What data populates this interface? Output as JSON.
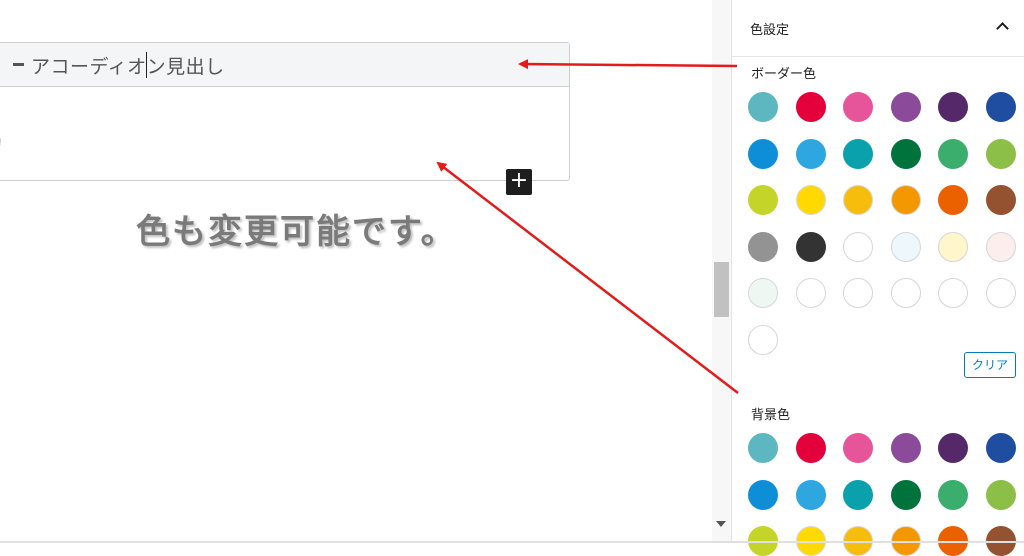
{
  "editor": {
    "accordion_title": "アコーディオン見出し",
    "body_placeholder": "カ",
    "add_block_symbol": "+",
    "caption": "色も変更可能です。"
  },
  "sidebar": {
    "panel_title": "色設定",
    "border_label": "ボーダー色",
    "background_label": "背景色",
    "clear_label": "クリア",
    "border_colors": [
      "#5db7c1",
      "#e4003a",
      "#e6549a",
      "#8b4a9a",
      "#55286a",
      "#1f4ea0",
      "#0f8ed8",
      "#2ea7e0",
      "#0aa1ad",
      "#00733d",
      "#3bae6e",
      "#8bbf47",
      "#c5d428",
      "#ffd900",
      "#f7bd0d",
      "#f39800",
      "#eb6100",
      "#955230",
      "#939393",
      "#333333",
      "#ffffff",
      "#eef7fb",
      "#fff6cc",
      "#fdeeee",
      "#eef7f1",
      "#ffffff",
      "#ffffff",
      "#ffffff",
      "#ffffff",
      "#ffffff",
      "#ffffff"
    ],
    "background_colors": [
      "#5db7c1",
      "#e4003a",
      "#e6549a",
      "#8b4a9a",
      "#55286a",
      "#1f4ea0",
      "#0f8ed8",
      "#2ea7e0",
      "#0aa1ad",
      "#00733d",
      "#3bae6e",
      "#8bbf47",
      "#c5d428",
      "#ffd900",
      "#f7bd0d",
      "#f39800",
      "#eb6100",
      "#955230"
    ]
  },
  "annotation_color": "#e31b1b"
}
